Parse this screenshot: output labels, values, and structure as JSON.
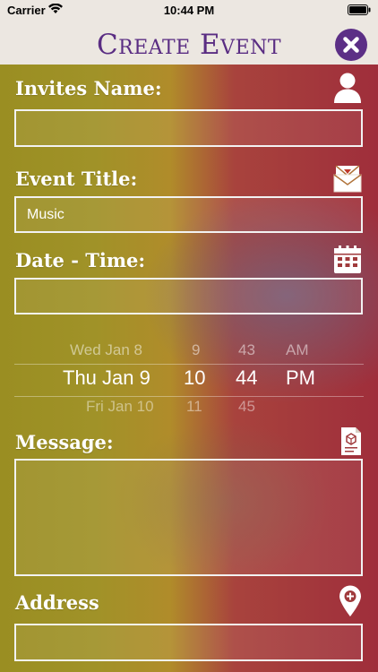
{
  "status_bar": {
    "carrier": "Carrier",
    "time": "10:44 PM"
  },
  "header": {
    "title": "Create Event",
    "title_color": "#5a2d83"
  },
  "form": {
    "invites_name": {
      "label": "Invites Name:",
      "value": "",
      "icon": "user-icon"
    },
    "event_title": {
      "label": "Event Title:",
      "value": "Music",
      "icon": "envelope-icon"
    },
    "date_time": {
      "label": "Date - Time:",
      "value": "",
      "icon": "calendar-icon",
      "picker": {
        "previous": {
          "date": "Wed Jan 8",
          "hour": "9",
          "minute": "43",
          "period": "AM"
        },
        "selected": {
          "date": "Thu Jan 9",
          "hour": "10",
          "minute": "44",
          "period": "PM"
        },
        "next": {
          "date": "Fri Jan 10",
          "hour": "11",
          "minute": "45",
          "period": ""
        }
      }
    },
    "message": {
      "label": "Message:",
      "value": "",
      "icon": "document-icon"
    },
    "address": {
      "label": "Address",
      "value": "",
      "icon": "map-pin-icon"
    }
  }
}
